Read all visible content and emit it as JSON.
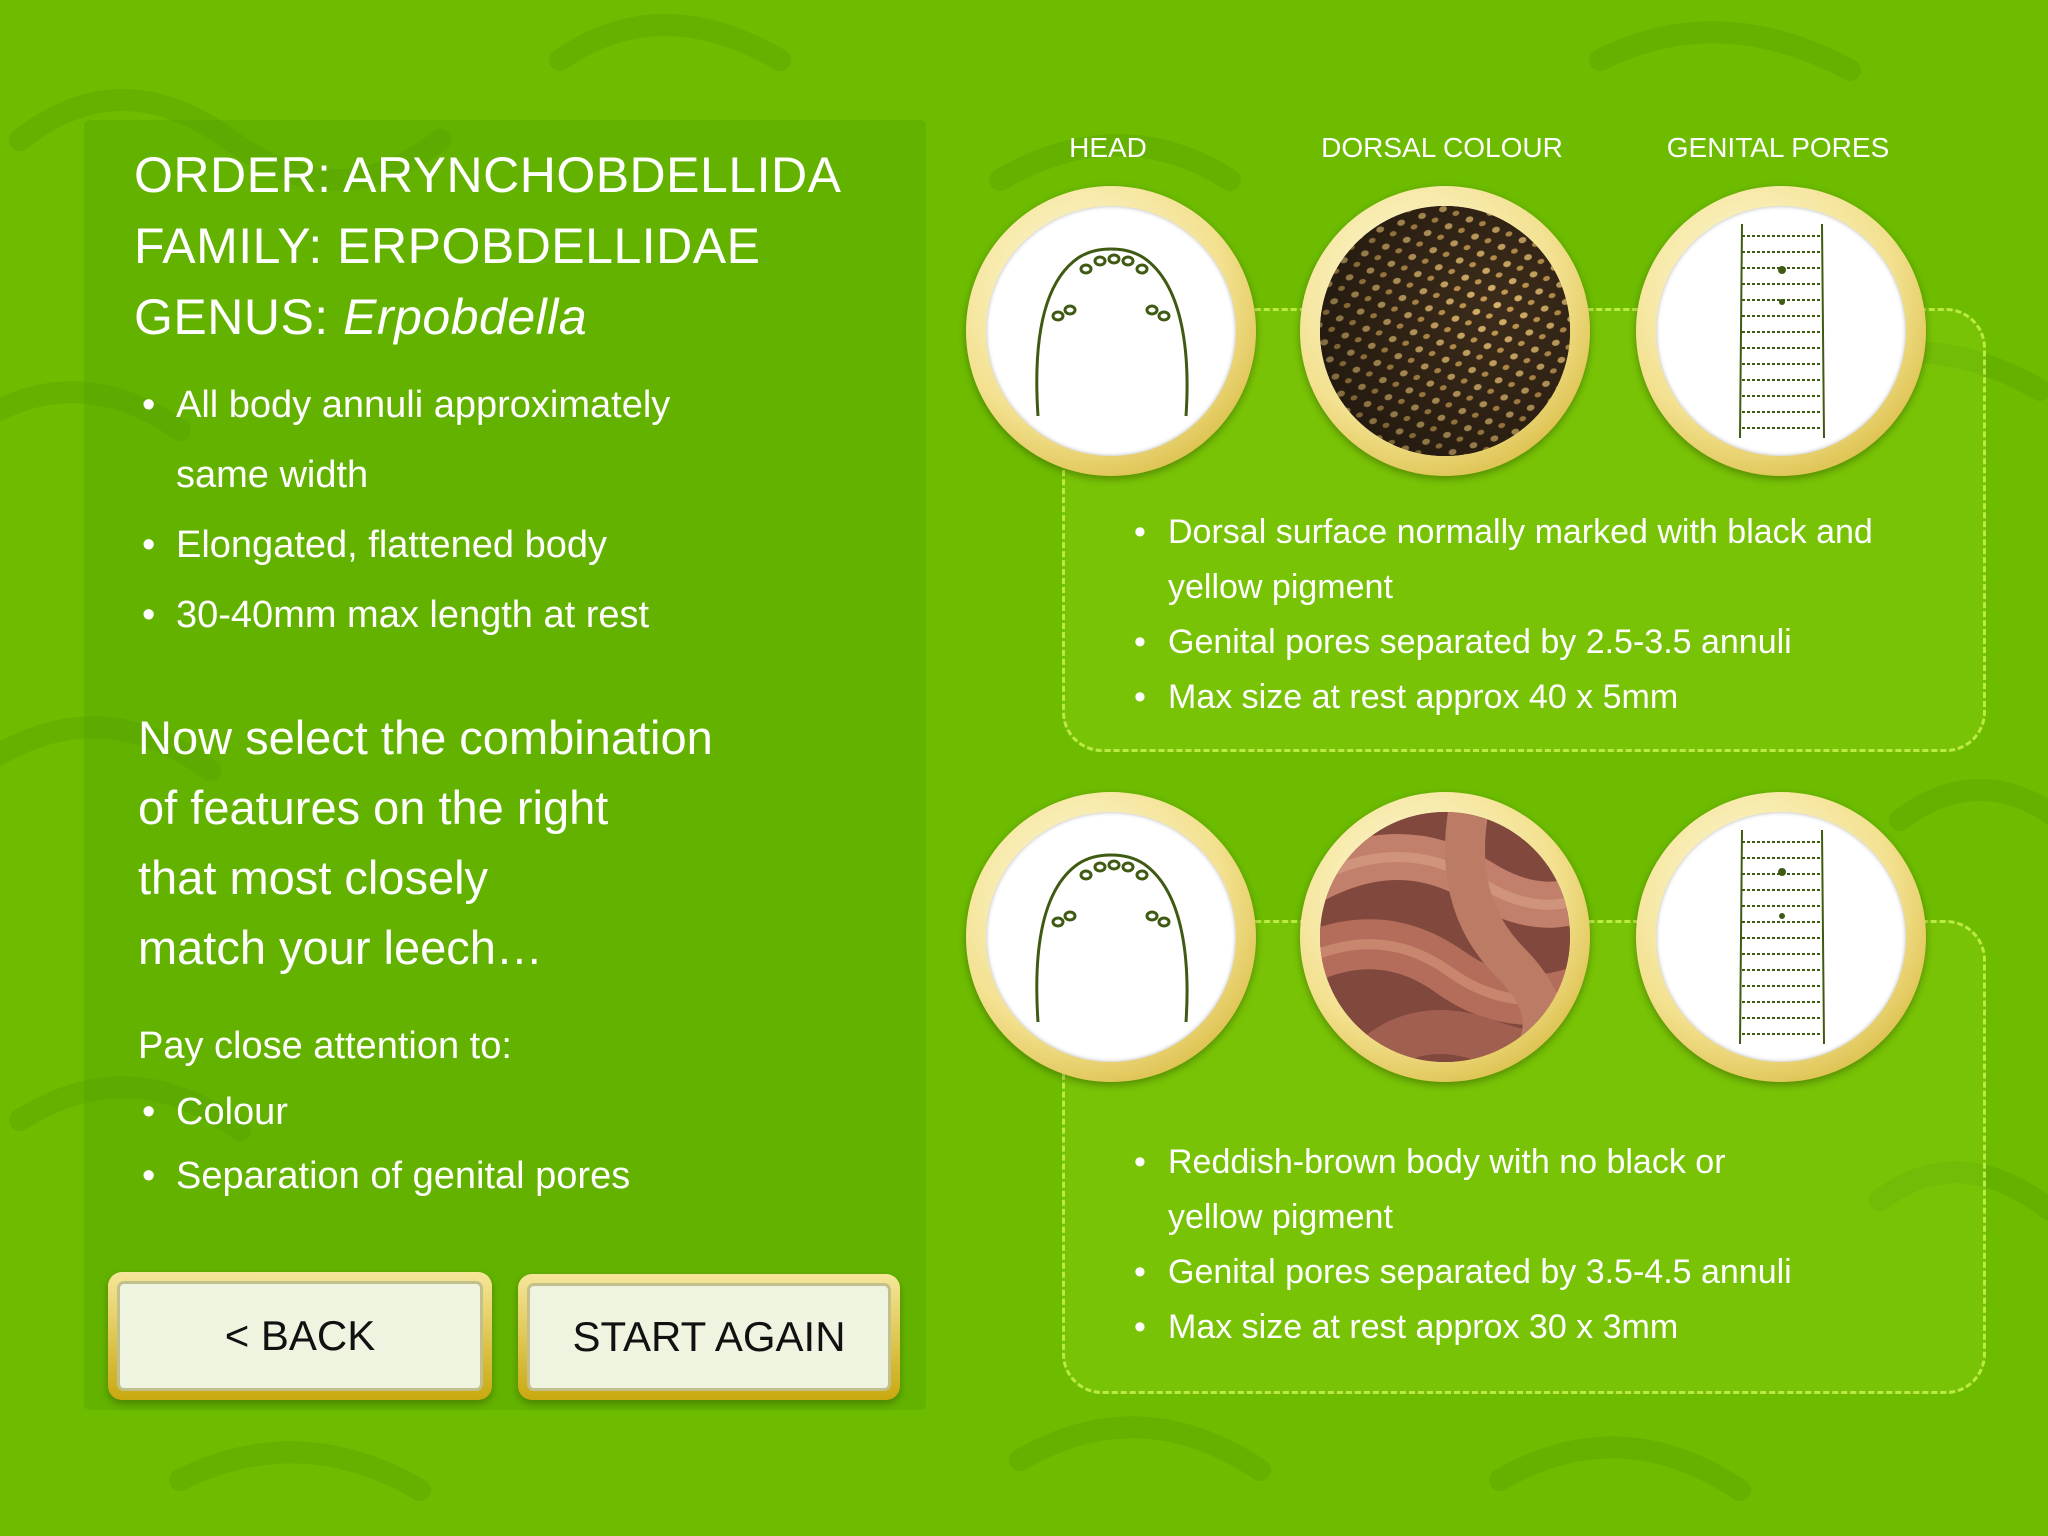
{
  "taxonomy": {
    "order": "ORDER: ARYNCHOBDELLIDA",
    "family": "FAMILY: ERPOBDELLIDAE",
    "genus_label": "GENUS: ",
    "genus_name": "Erpobdella"
  },
  "traits": [
    "All body annuli approximately",
    "same width",
    "Elongated, flattened body",
    "30-40mm max length at rest"
  ],
  "prompt": [
    "Now select the combination",
    "of features on the right",
    "that most closely",
    "match your leech…"
  ],
  "attention": {
    "heading": "Pay close attention to:",
    "items": [
      "Colour",
      "Separation of genital pores"
    ]
  },
  "buttons": {
    "back": "< BACK",
    "start_again": "START AGAIN"
  },
  "columns": {
    "head": "HEAD",
    "dorsal": "DORSAL COLOUR",
    "pores": "GENITAL PORES"
  },
  "options": [
    {
      "dorsal_image": "black-and-yellow-spotted-leech-photo",
      "lines": [
        "Dorsal surface normally marked with black and",
        "yellow pigment",
        "Genital pores separated by 2.5-3.5 annuli",
        "Max size at rest approx 40 x 5mm"
      ]
    },
    {
      "dorsal_image": "reddish-brown-coiled-leech-photo",
      "lines": [
        "Reddish-brown body with no black or",
        "yellow pigment",
        "Genital pores separated by 3.5-4.5 annuli",
        "Max size at rest approx 30 x 3mm"
      ]
    }
  ],
  "colors": {
    "background": "#6dbc00",
    "gold": "#c9a514",
    "button_face": "#eef4df",
    "drawing_ink": "#3f5a12"
  }
}
